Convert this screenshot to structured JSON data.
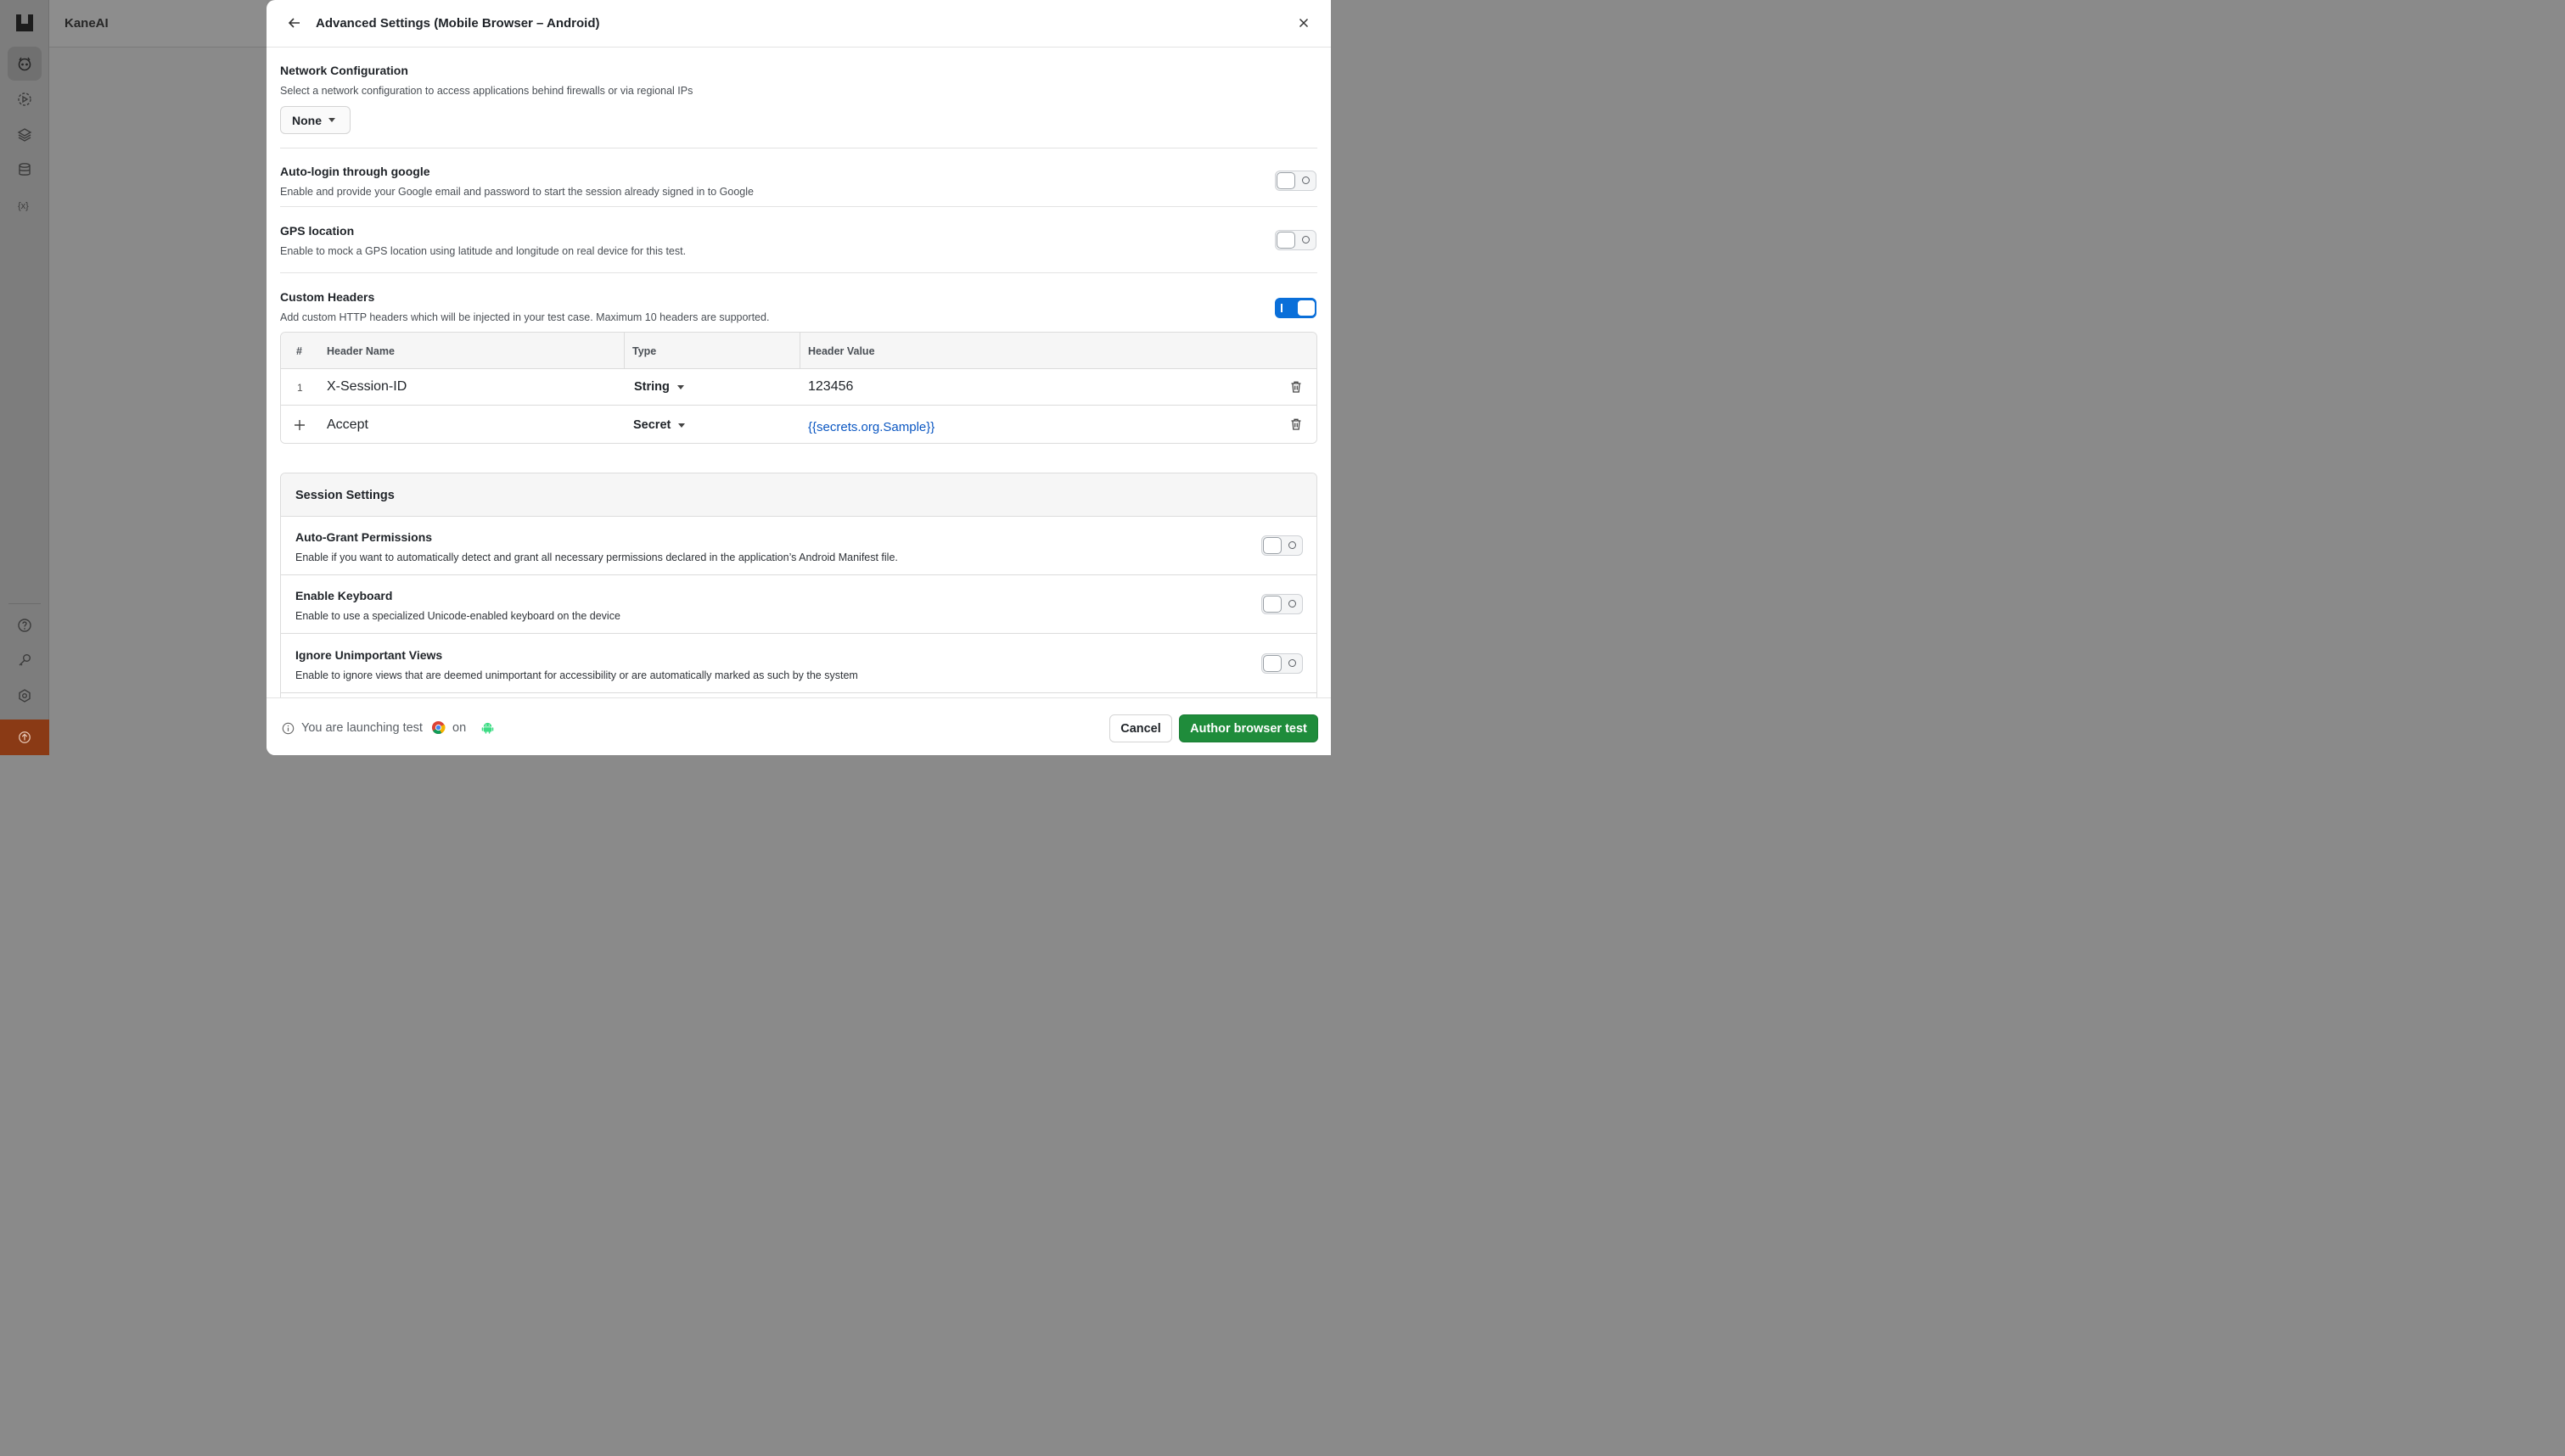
{
  "app": {
    "name": "KaneAI"
  },
  "drawer": {
    "title": "Advanced Settings (Mobile Browser – Android)"
  },
  "network": {
    "title": "Network Configuration",
    "description": "Select a network configuration to access applications behind firewalls or via regional IPs",
    "selected": "None"
  },
  "autologin": {
    "title": "Auto-login through google",
    "description": "Enable and provide your Google email and password to start the session already signed in to Google",
    "enabled": false
  },
  "gps": {
    "title": "GPS location",
    "description": "Enable to mock a GPS location using latitude and longitude on real device for this test.",
    "enabled": false
  },
  "custom_headers": {
    "title": "Custom Headers",
    "description": "Add custom HTTP headers which will be injected in your test case. Maximum 10 headers are supported.",
    "enabled": true,
    "columns": {
      "index": "#",
      "name": "Header Name",
      "type": "Type",
      "value": "Header Value"
    },
    "rows": [
      {
        "index": "1",
        "name": "X-Session-ID",
        "type": "String",
        "value": "123456"
      },
      {
        "index": "+",
        "name": "Accept",
        "type": "Secret",
        "value": "{{secrets.org.Sample}}"
      }
    ]
  },
  "session_settings": {
    "title": "Session Settings",
    "items": [
      {
        "title": "Auto-Grant Permissions",
        "description": "Enable if you want to automatically detect and grant all necessary permissions declared in the application’s Android Manifest file.",
        "enabled": false
      },
      {
        "title": "Enable Keyboard",
        "description": "Enable to use a specialized Unicode-enabled keyboard on the device",
        "enabled": false
      },
      {
        "title": "Ignore Unimportant Views",
        "description": "Enable to ignore views that are deemed unimportant for accessibility or are automatically marked as such by the system",
        "enabled": false
      }
    ]
  },
  "footer": {
    "launch_text": "You are launching test",
    "on_text": "on",
    "cancel_label": "Cancel",
    "primary_label": "Author browser test"
  },
  "colors": {
    "primary_button": "#1f8c3b",
    "toggle_on": "#0a6fd9",
    "secret_link": "#0b57c2",
    "upgrade_bg": "#8a3a15"
  },
  "icons": {
    "rail": [
      "kane-logo-icon",
      "kane-agent-icon",
      "test-run-icon",
      "layers-icon",
      "database-icon",
      "variables-icon",
      "help-icon",
      "key-icon",
      "settings-icon",
      "upgrade-icon"
    ],
    "header": [
      "back-arrow-icon",
      "close-icon"
    ],
    "footer": [
      "info-icon",
      "chrome-icon",
      "android-icon"
    ],
    "table": [
      "plus-icon",
      "trash-icon",
      "chevron-down-icon"
    ]
  }
}
